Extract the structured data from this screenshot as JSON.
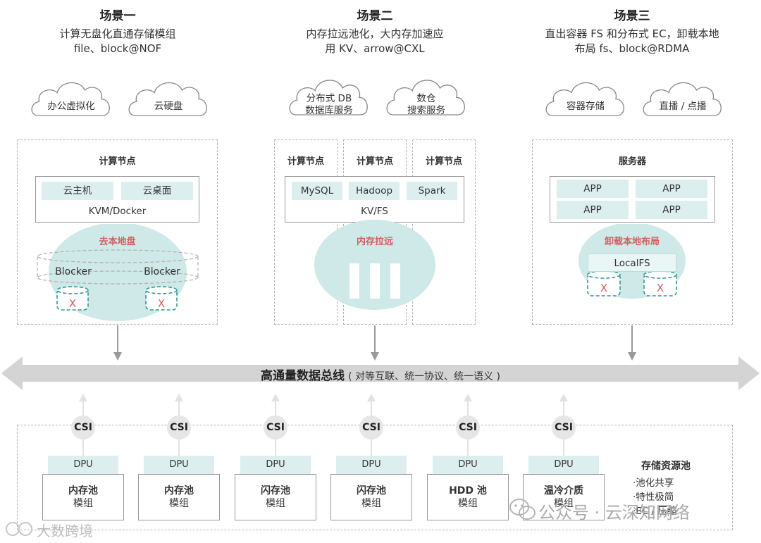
{
  "scenarios": [
    {
      "title": "场景一",
      "subtitle": [
        "计算无盘化直通存储模组",
        "file、block@NOF"
      ]
    },
    {
      "title": "场景二",
      "subtitle": [
        "内存拉远池化，大内存加速应",
        "用   KV、arrow@CXL"
      ]
    },
    {
      "title": "场景三",
      "subtitle": [
        "直出容器 FS 和分布式 EC，卸载本地",
        "布局 fs、block@RDMA"
      ]
    }
  ],
  "clouds": [
    {
      "lines": [
        "办公虚拟化"
      ]
    },
    {
      "lines": [
        "云硬盘"
      ]
    },
    {
      "lines": [
        "分布式 DB",
        "数据库服务"
      ]
    },
    {
      "lines": [
        "数仓",
        "搜索服务"
      ]
    },
    {
      "lines": [
        "容器存储"
      ]
    },
    {
      "lines": [
        "直播 / 点播"
      ]
    }
  ],
  "scene1": {
    "node_title": "计算节点",
    "vm1": "云主机",
    "vm2": "云桌面",
    "hypervisor": "KVM/Docker",
    "label": "去本地盘",
    "blocker_left": "Blocker",
    "blocker_right": "Blocker",
    "x_mark": "X"
  },
  "scene2": {
    "node_titles": [
      "计算节点",
      "计算节点",
      "计算节点"
    ],
    "apps": [
      "MySQL",
      "Hadoop",
      "Spark"
    ],
    "kv": "KV/FS",
    "label": "内存拉远"
  },
  "scene3": {
    "node_title": "服务器",
    "apps": [
      "APP",
      "APP",
      "APP",
      "APP"
    ],
    "label": "卸载本地布局",
    "localfs": "LocalFS",
    "x_mark": "X"
  },
  "bus": {
    "title": "高通量数据总线",
    "detail": "( 对等互联、统一协议、统一语义 )"
  },
  "modules": [
    {
      "csi": "CSI",
      "dpu": "DPU",
      "name": "内存池",
      "sub": "模组"
    },
    {
      "csi": "CSI",
      "dpu": "DPU",
      "name": "内存池",
      "sub": "模组"
    },
    {
      "csi": "CSI",
      "dpu": "DPU",
      "name": "闪存池",
      "sub": "模组"
    },
    {
      "csi": "CSI",
      "dpu": "DPU",
      "name": "闪存池",
      "sub": "模组"
    },
    {
      "csi": "CSI",
      "dpu": "DPU",
      "name": "HDD 池",
      "sub": "模组"
    },
    {
      "csi": "CSI",
      "dpu": "DPU",
      "name": "温冷介质",
      "sub": "模组"
    }
  ],
  "pool": {
    "title": "存储资源池",
    "features": [
      "·池化共享",
      "·特性极简",
      "·EC / 压缩"
    ]
  },
  "watermarks": {
    "right": "公众号 · 云深知网络",
    "left": "大数跨境"
  },
  "colors": {
    "teal_fill": "#ddeeee",
    "teal_ellipse": "#cfe8e8",
    "teal_dash": "#2f9a93",
    "accent_red": "#d06060",
    "bus_gray": "#d4d4d4",
    "arrow_gray": "#9a9a9a"
  }
}
